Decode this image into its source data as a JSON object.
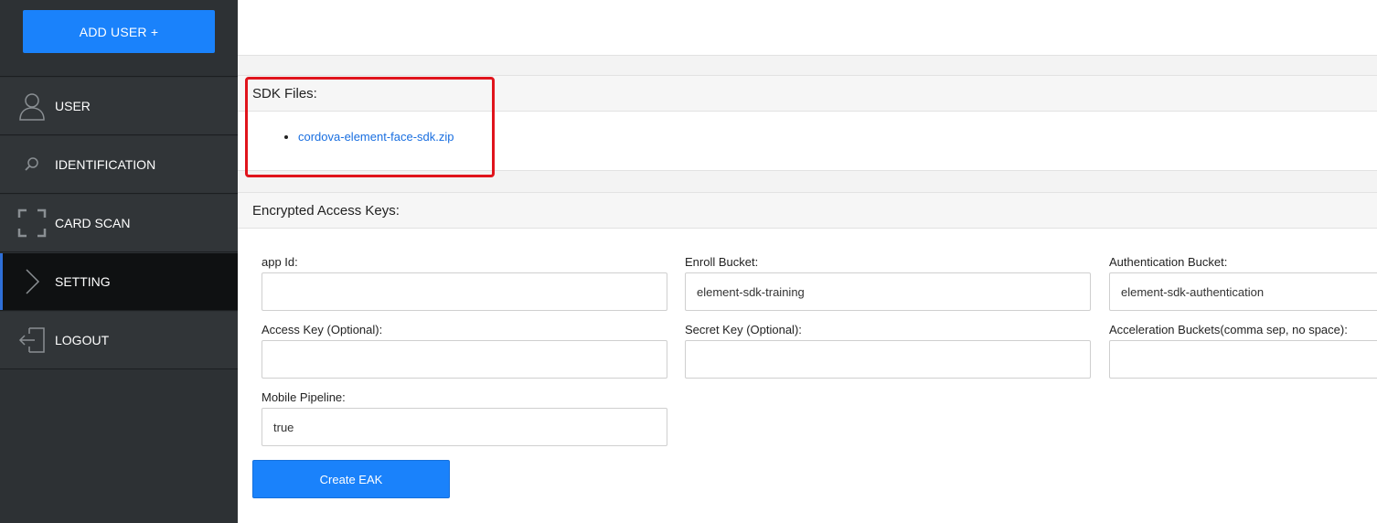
{
  "sidebar": {
    "add_user_label": "ADD USER +",
    "items": [
      {
        "label": "USER",
        "icon": "user-icon"
      },
      {
        "label": "IDENTIFICATION",
        "icon": "search-icon"
      },
      {
        "label": "CARD SCAN",
        "icon": "scan-frame-icon"
      },
      {
        "label": "SETTING",
        "icon": "chevron-right-icon",
        "active": true
      },
      {
        "label": "LOGOUT",
        "icon": "logout-icon"
      }
    ]
  },
  "sdk": {
    "title": "SDK Files:",
    "files": [
      "cordova-element-face-sdk.zip"
    ]
  },
  "eak": {
    "title": "Encrypted Access Keys:",
    "fields": {
      "app_id": {
        "label": "app Id:",
        "value": ""
      },
      "enroll_bucket": {
        "label": "Enroll Bucket:",
        "value": "element-sdk-training"
      },
      "auth_bucket": {
        "label": "Authentication Bucket:",
        "value": "element-sdk-authentication"
      },
      "access_key": {
        "label": "Access Key (Optional):",
        "value": ""
      },
      "secret_key": {
        "label": "Secret Key (Optional):",
        "value": ""
      },
      "accel_buckets": {
        "label": "Acceleration Buckets(comma sep, no space):",
        "value": ""
      },
      "mobile_pipeline": {
        "label": "Mobile Pipeline:",
        "value": "true"
      }
    },
    "create_label": "Create EAK"
  },
  "colors": {
    "accent": "#1a82fb",
    "highlight": "#e0141c",
    "sidebar_bg": "#2d3134",
    "active_bg": "#0f1112"
  }
}
